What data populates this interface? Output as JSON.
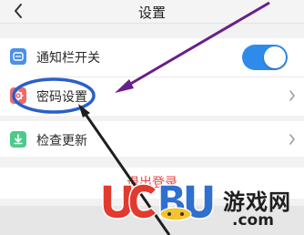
{
  "header": {
    "title": "设置",
    "back_icon": "chevron-left-icon"
  },
  "settings": [
    {
      "label": "通知栏开关",
      "icon": "notification-icon",
      "control": "toggle",
      "toggle_on": true
    },
    {
      "label": "密码设置",
      "icon": "gear-icon",
      "control": "chevron"
    },
    {
      "label": "检查更新",
      "icon": "update-icon",
      "control": "chevron"
    }
  ],
  "logout": {
    "label": "退出登录"
  },
  "watermark": {
    "text": "UCBUG游戏网",
    "domain": ".com"
  },
  "colors": {
    "accent": "#2f8bea",
    "logout": "#e64545",
    "highlight_ring": "#2b5fc8",
    "arrow_purple": "#6a1f8a",
    "arrow_dark": "#1e1e1e"
  }
}
